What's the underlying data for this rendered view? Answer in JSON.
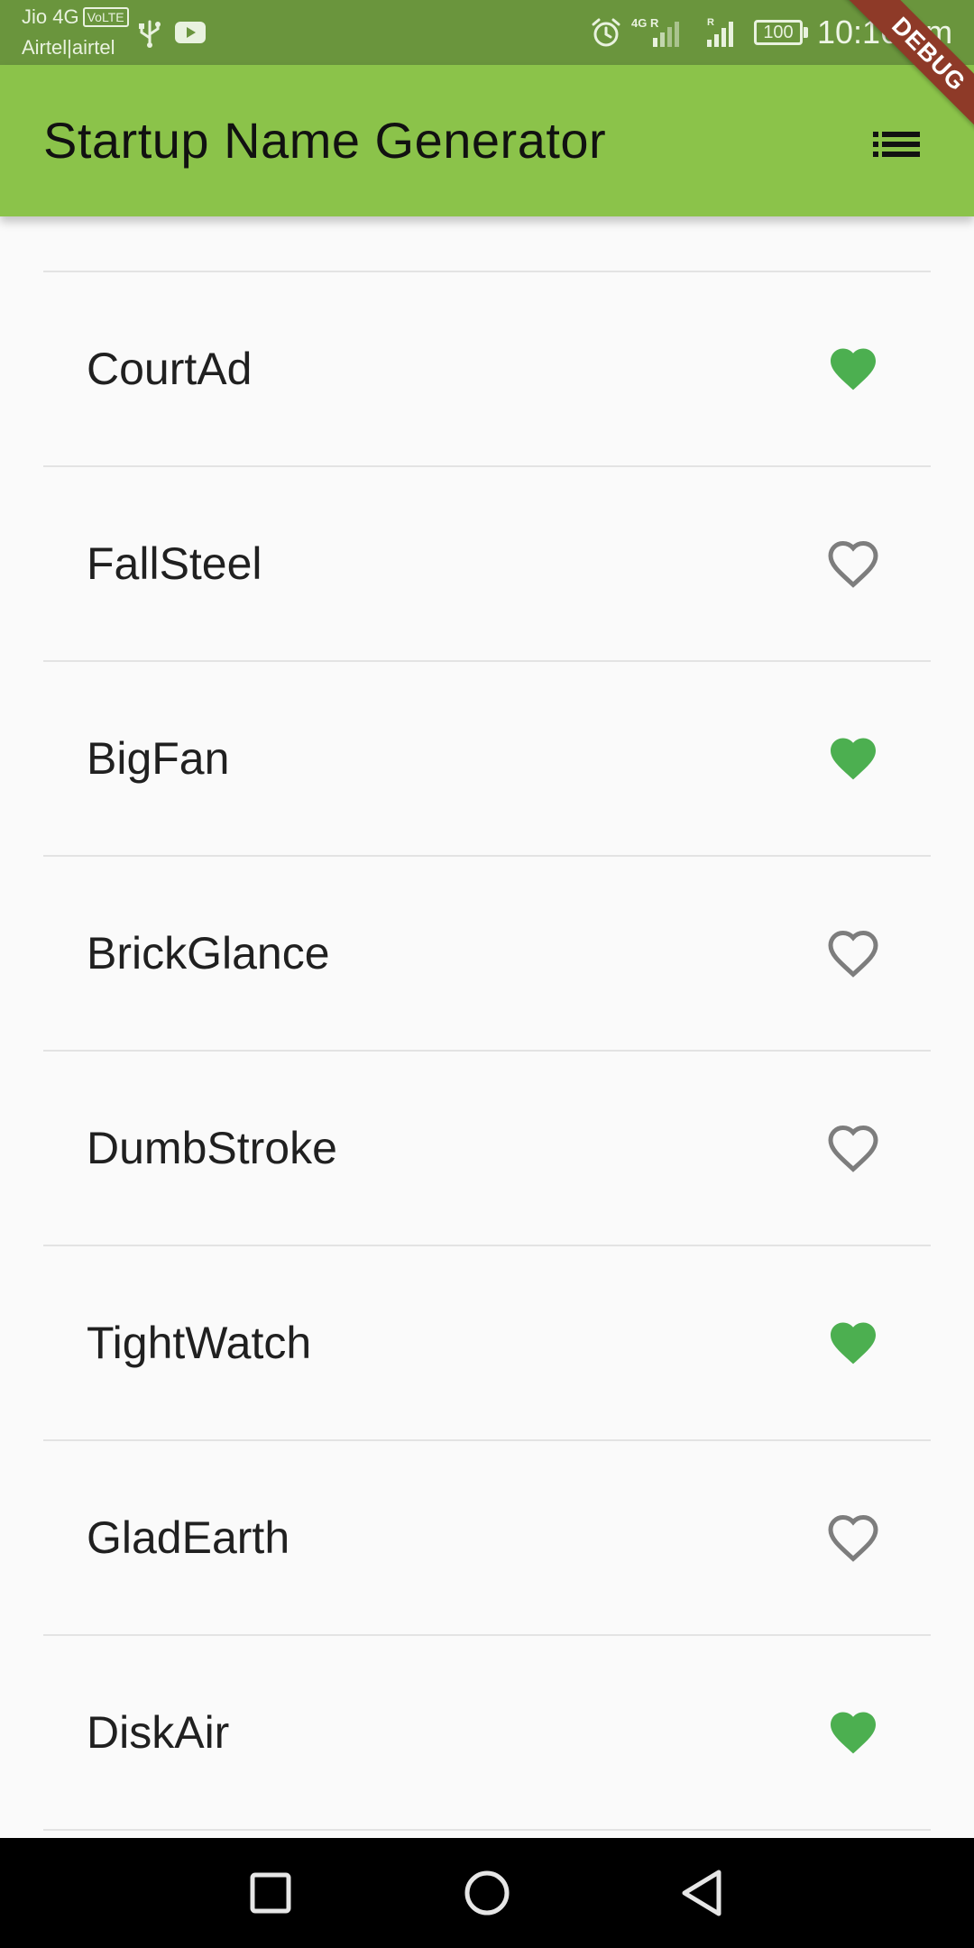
{
  "status_bar": {
    "carrier_primary": "Jio 4G",
    "volte_label": "VoLTE",
    "carrier_secondary": "Airtel|airtel",
    "network_4g_label": "4G R",
    "battery_level": "100",
    "time": "10:16 pm"
  },
  "app_bar": {
    "title": "Startup Name Generator",
    "background_color": "#8bc34a",
    "action_icon": "list-icon"
  },
  "debug_banner": {
    "label": "DEBUG",
    "color": "#8e3a28"
  },
  "favorite_color": "#4caf50",
  "names": [
    {
      "label": "CourtAd",
      "favorite": true
    },
    {
      "label": "FallSteel",
      "favorite": false
    },
    {
      "label": "BigFan",
      "favorite": true
    },
    {
      "label": "BrickGlance",
      "favorite": false
    },
    {
      "label": "DumbStroke",
      "favorite": false
    },
    {
      "label": "TightWatch",
      "favorite": true
    },
    {
      "label": "GladEarth",
      "favorite": false
    },
    {
      "label": "DiskAir",
      "favorite": true
    }
  ],
  "nav_bar": {
    "icons": [
      "recent-apps-icon",
      "home-icon",
      "back-icon"
    ]
  }
}
